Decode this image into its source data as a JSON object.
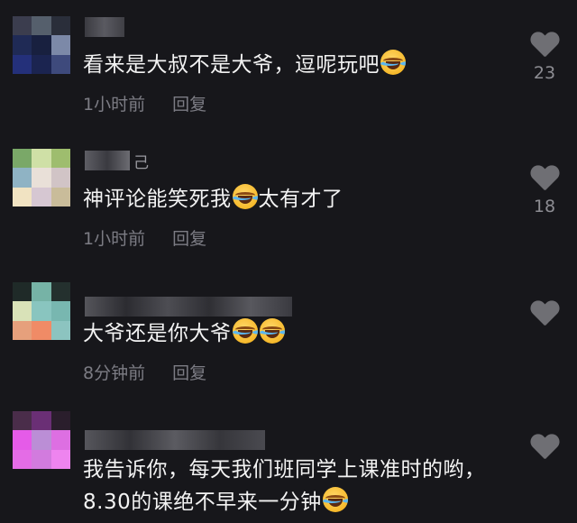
{
  "comments": [
    {
      "username": "",
      "text": "看来是大叔不是大爷，逗呢玩吧",
      "text_after": "",
      "emojis_after_text": [
        "laugh-cry"
      ],
      "time": "1小时前",
      "reply": "回复",
      "likes": "23",
      "avatar_colors": [
        "#3b3d4e",
        "#555f6c",
        "#2a2e3a",
        "#1f2a55",
        "#18203f",
        "#7c89a8",
        "#24307a",
        "#1b2450",
        "#3e4a7c"
      ]
    },
    {
      "username": "",
      "username_suffix": "己",
      "text": "神评论能笑死我",
      "text_after": "太有才了",
      "emojis_after_text": [
        "laugh-cry"
      ],
      "time": "1小时前",
      "reply": "回复",
      "likes": "18",
      "avatar_colors": [
        "#7aa868",
        "#cfe0a6",
        "#9ebd6e",
        "#8fb3c4",
        "#e9e0d8",
        "#d1c4c6",
        "#f1e3c2",
        "#d6c7d2",
        "#c9bc9a"
      ]
    },
    {
      "username": "",
      "text": "大爷还是你大爷",
      "text_after": "",
      "emojis_after_text": [
        "laugh-cry",
        "laugh-cry"
      ],
      "time": "8分钟前",
      "reply": "回复",
      "likes": "",
      "avatar_colors": [
        "#1f2a28",
        "#76b3a6",
        "#24302e",
        "#d9e2b8",
        "#89c5bf",
        "#78b7b0",
        "#e6a07c",
        "#f08b66",
        "#8cc4c0"
      ]
    },
    {
      "username": "",
      "text": "我告诉你，每天我们班同学上课准时的哟，8.30的课绝不早来一分钟",
      "text_after": "",
      "emojis_after_text": [
        "laugh-cry"
      ],
      "time": "",
      "reply": "",
      "likes": "",
      "avatar_colors": [
        "#4a2d4a",
        "#6a2f75",
        "#2a1e2c",
        "#e55be8",
        "#bb8ed6",
        "#dd6fe2",
        "#e46ce6",
        "#d27bde",
        "#ee84ef"
      ]
    }
  ]
}
